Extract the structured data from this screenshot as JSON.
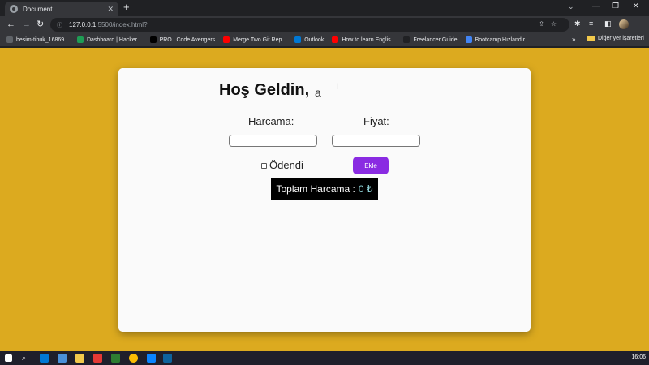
{
  "browser": {
    "tab_title": "Document",
    "url_host": "127.0.0.1",
    "url_rest": ":5500/index.html?",
    "bookmarks": [
      {
        "label": "besim-tibuk_16869...",
        "color": "#5f6368"
      },
      {
        "label": "Dashboard | Hacker...",
        "color": "#1f9d55"
      },
      {
        "label": "PRO | Code Avengers",
        "color": "#000000"
      },
      {
        "label": "Merge Two Git Rep...",
        "color": "#ff0000"
      },
      {
        "label": "Outlook",
        "color": "#0078d4"
      },
      {
        "label": "How to learn Englis...",
        "color": "#ff0000"
      },
      {
        "label": "Freelancer Guide",
        "color": "#202124"
      },
      {
        "label": "Bootcamp Hızlandır...",
        "color": "#4285f4"
      }
    ],
    "bookmarks_more": "»",
    "other_bookmarks": "Diğer yer işaretleri"
  },
  "app": {
    "greeting": "Hoş Geldin,",
    "username": "a",
    "expense_label": "Harcama:",
    "price_label": "Fiyat:",
    "expense_value": "",
    "price_value": "",
    "paid_label": "Ödendi",
    "add_button": "Ekle",
    "total_label": "Toplam Harcama :",
    "total_value": "0 ₺"
  },
  "taskbar": {
    "time": "16:06"
  },
  "colors": {
    "page_background": "#dcaa1f",
    "add_button": "#8a2be2",
    "total_box": "#000000"
  }
}
